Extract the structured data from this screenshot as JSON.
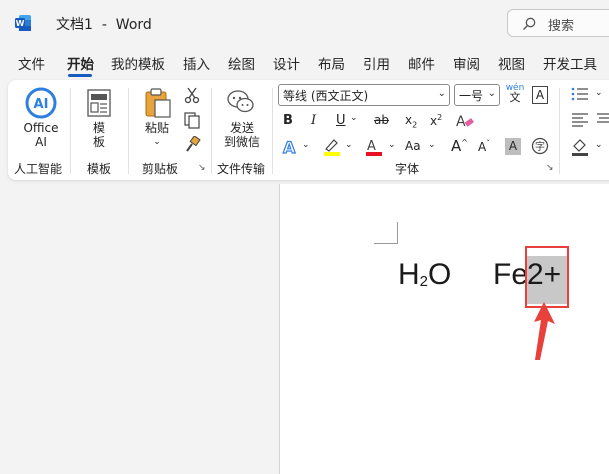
{
  "titlebar": {
    "doc_name": "文档1",
    "separator": "-",
    "app_name": "Word",
    "search_placeholder": "搜索"
  },
  "tabs": [
    {
      "label": "文件"
    },
    {
      "label": "开始",
      "active": true
    },
    {
      "label": "我的模板"
    },
    {
      "label": "插入"
    },
    {
      "label": "绘图"
    },
    {
      "label": "设计"
    },
    {
      "label": "布局"
    },
    {
      "label": "引用"
    },
    {
      "label": "邮件"
    },
    {
      "label": "审阅"
    },
    {
      "label": "视图"
    },
    {
      "label": "开发工具"
    }
  ],
  "ribbon": {
    "office_ai": {
      "line1": "Office",
      "line2": "AI",
      "group": "人工智能"
    },
    "template": {
      "line1": "模",
      "line2": "板",
      "group": "模板"
    },
    "clipboard": {
      "paste": "粘贴",
      "group": "剪贴板"
    },
    "wechat": {
      "line1": "发送",
      "line2": "到微信",
      "group": "文件传输"
    },
    "font": {
      "font_name": "等线 (西文正文)",
      "font_size": "一号",
      "phonetic": "wén",
      "bold": "B",
      "italic": "I",
      "underline": "U",
      "strike": "ab",
      "subscript": "x",
      "superscript": "x",
      "grow": "A",
      "shrink": "A",
      "case": "Aa",
      "group": "字体"
    }
  },
  "document": {
    "formula_h": "H",
    "formula_sub": "2",
    "formula_o": "O",
    "fe_text": "Fe",
    "selected_text": "2+"
  },
  "colors": {
    "accent": "#185abd",
    "highlight": "#c8c8c8",
    "annotation": "#e8403a",
    "font_color": "#e81123",
    "highlighter": "#ffff00"
  }
}
